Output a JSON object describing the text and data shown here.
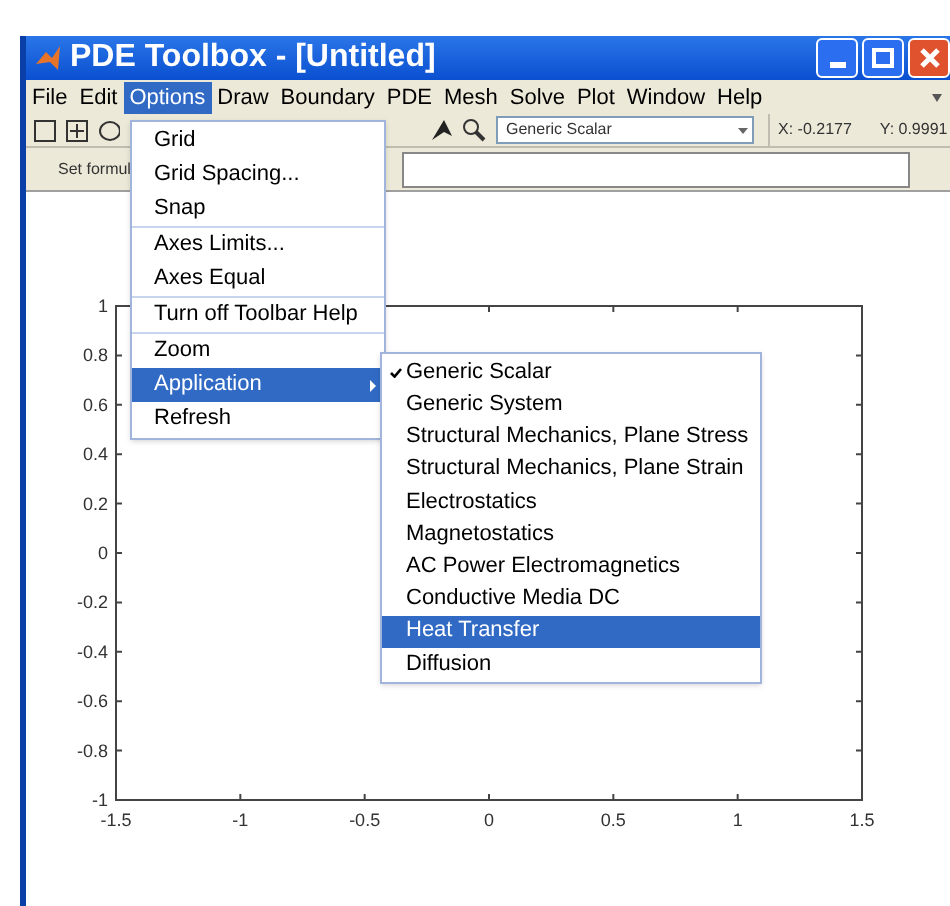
{
  "window": {
    "title": "PDE Toolbox - [Untitled]"
  },
  "menu_bar": [
    {
      "label": "File",
      "selected": false
    },
    {
      "label": "Edit",
      "selected": false
    },
    {
      "label": "Options",
      "selected": true
    },
    {
      "label": "Draw",
      "selected": false
    },
    {
      "label": "Boundary",
      "selected": false
    },
    {
      "label": "PDE",
      "selected": false
    },
    {
      "label": "Mesh",
      "selected": false
    },
    {
      "label": "Solve",
      "selected": false
    },
    {
      "label": "Plot",
      "selected": false
    },
    {
      "label": "Window",
      "selected": false
    },
    {
      "label": "Help",
      "selected": false
    }
  ],
  "toolbar": {
    "dropdown": {
      "value": "Generic Scalar"
    },
    "x_reading": "X: -0.2177",
    "y_reading": "Y: 0.9991"
  },
  "formula_bar": {
    "label": "Set formul"
  },
  "options_menu": {
    "groups": [
      [
        {
          "label": "Grid",
          "selected": false,
          "has_submenu": false
        },
        {
          "label": "Grid Spacing...",
          "selected": false,
          "has_submenu": false
        },
        {
          "label": "Snap",
          "selected": false,
          "has_submenu": false
        }
      ],
      [
        {
          "label": "Axes Limits...",
          "selected": false,
          "has_submenu": false
        },
        {
          "label": "Axes Equal",
          "selected": false,
          "has_submenu": false
        }
      ],
      [
        {
          "label": "Turn off Toolbar Help",
          "selected": false,
          "has_submenu": false
        }
      ],
      [
        {
          "label": "Zoom",
          "selected": false,
          "has_submenu": false
        },
        {
          "label": "Application",
          "selected": true,
          "has_submenu": true
        },
        {
          "label": "Refresh",
          "selected": false,
          "has_submenu": false
        }
      ]
    ]
  },
  "application_submenu": [
    {
      "label": "Generic Scalar",
      "checked": true,
      "selected": false
    },
    {
      "label": "Generic System",
      "checked": false,
      "selected": false
    },
    {
      "label": "Structural Mechanics, Plane Stress",
      "checked": false,
      "selected": false
    },
    {
      "label": "Structural Mechanics, Plane Strain",
      "checked": false,
      "selected": false
    },
    {
      "label": "Electrostatics",
      "checked": false,
      "selected": false
    },
    {
      "label": "Magnetostatics",
      "checked": false,
      "selected": false
    },
    {
      "label": "AC Power Electromagnetics",
      "checked": false,
      "selected": false
    },
    {
      "label": "Conductive Media DC",
      "checked": false,
      "selected": false
    },
    {
      "label": "Heat Transfer",
      "checked": false,
      "selected": true
    },
    {
      "label": "Diffusion",
      "checked": false,
      "selected": false
    }
  ],
  "chart_data": {
    "type": "line",
    "xlim": [
      -1.5,
      1.5
    ],
    "ylim": [
      -1,
      1
    ],
    "xticks": [
      -1.5,
      -1,
      -0.5,
      0,
      0.5,
      1,
      1.5
    ],
    "yticks": [
      -1,
      -0.8,
      -0.6,
      -0.4,
      -0.2,
      0,
      0.2,
      0.4,
      0.6,
      0.8,
      1
    ]
  }
}
